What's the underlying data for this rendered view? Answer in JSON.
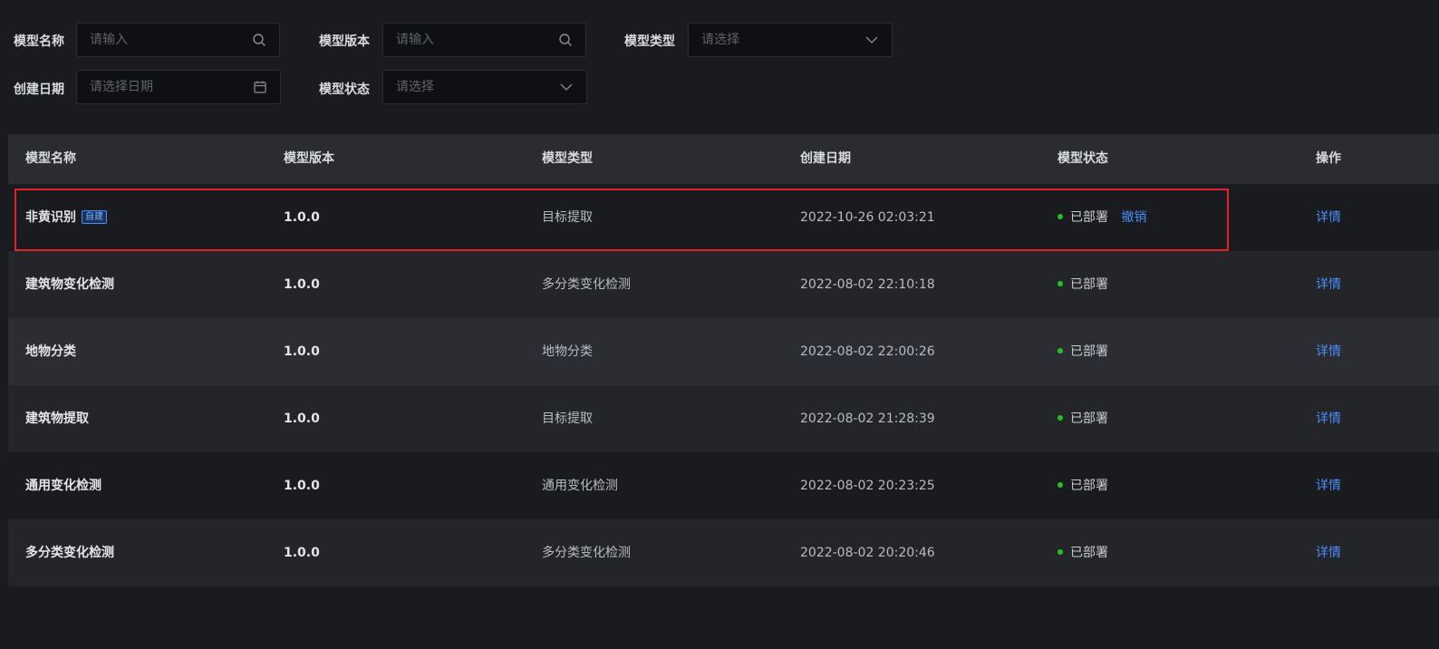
{
  "filters": {
    "name": {
      "label": "模型名称",
      "placeholder": "请输入",
      "icon": "search-icon"
    },
    "version": {
      "label": "模型版本",
      "placeholder": "请输入",
      "icon": "search-icon"
    },
    "type": {
      "label": "模型类型",
      "placeholder": "请选择",
      "icon": "chevron-down-icon"
    },
    "date": {
      "label": "创建日期",
      "placeholder": "请选择日期",
      "icon": "calendar-icon"
    },
    "status": {
      "label": "模型状态",
      "placeholder": "请选择",
      "icon": "chevron-down-icon"
    }
  },
  "table": {
    "headers": {
      "name": "模型名称",
      "version": "模型版本",
      "type": "模型类型",
      "date": "创建日期",
      "status": "模型状态",
      "action": "操作"
    },
    "rows": [
      {
        "name": "非黄识别",
        "badge": "自建",
        "version": "1.0.0",
        "type": "目标提取",
        "date": "2022-10-26 02:03:21",
        "status": "已部署",
        "revoke": "撤销",
        "detail": "详情"
      },
      {
        "name": "建筑物变化检测",
        "version": "1.0.0",
        "type": "多分类变化检测",
        "date": "2022-08-02 22:10:18",
        "status": "已部署",
        "detail": "详情"
      },
      {
        "name": "地物分类",
        "version": "1.0.0",
        "type": "地物分类",
        "date": "2022-08-02 22:00:26",
        "status": "已部署",
        "detail": "详情"
      },
      {
        "name": "建筑物提取",
        "version": "1.0.0",
        "type": "目标提取",
        "date": "2022-08-02 21:28:39",
        "status": "已部署",
        "detail": "详情"
      },
      {
        "name": "通用变化检测",
        "version": "1.0.0",
        "type": "通用变化检测",
        "date": "2022-08-02 20:23:25",
        "status": "已部署",
        "detail": "详情"
      },
      {
        "name": "多分类变化检测",
        "version": "1.0.0",
        "type": "多分类变化检测",
        "date": "2022-08-02 20:20:46",
        "status": "已部署",
        "detail": "详情"
      }
    ]
  },
  "colors": {
    "background": "#1a1b1e",
    "header_bg": "#2a2c31",
    "link": "#4b8df8",
    "status_deployed": "#22c51e",
    "highlight_border": "#e0222b"
  }
}
